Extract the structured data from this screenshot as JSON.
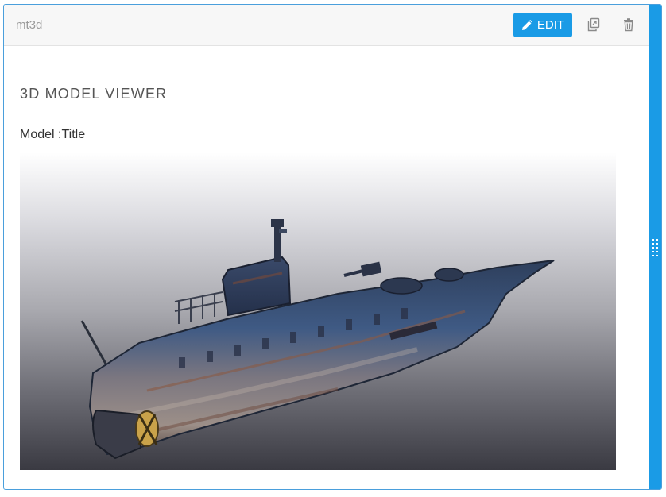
{
  "block": {
    "name": "mt3d",
    "edit_label": "EDIT",
    "edit_icon": "pencil-icon",
    "copy_icon": "copy-icon",
    "delete_icon": "trash-icon"
  },
  "viewer": {
    "heading": "3D MODEL VIEWER",
    "model_label": "Model :Title",
    "model_subject": "submarine-model"
  },
  "colors": {
    "accent": "#1a9be6",
    "header_bg": "#f7f7f7"
  }
}
